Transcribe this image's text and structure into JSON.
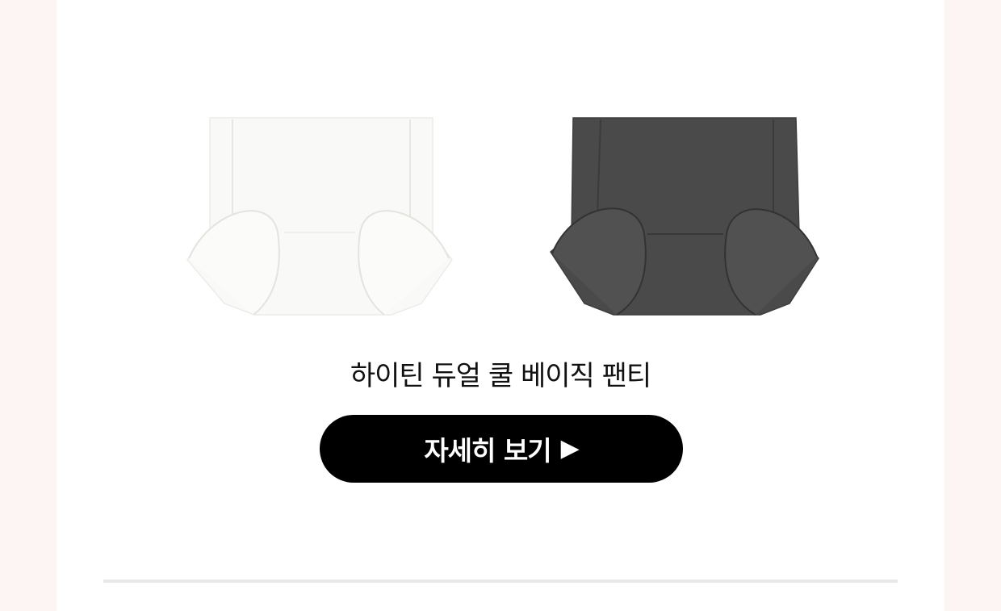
{
  "product": {
    "name": "하이틴 듀얼 쿨 베이직 팬티",
    "colors": {
      "white_variant": "#f9f9f7",
      "gray_variant": "#4a4a4a"
    }
  },
  "button": {
    "label": "자세히 보기",
    "arrow": "▶"
  },
  "theme": {
    "background_accent": "#fdf5f3",
    "panel": "#ffffff",
    "button_bg": "#000000",
    "divider": "#e8e8e8"
  }
}
